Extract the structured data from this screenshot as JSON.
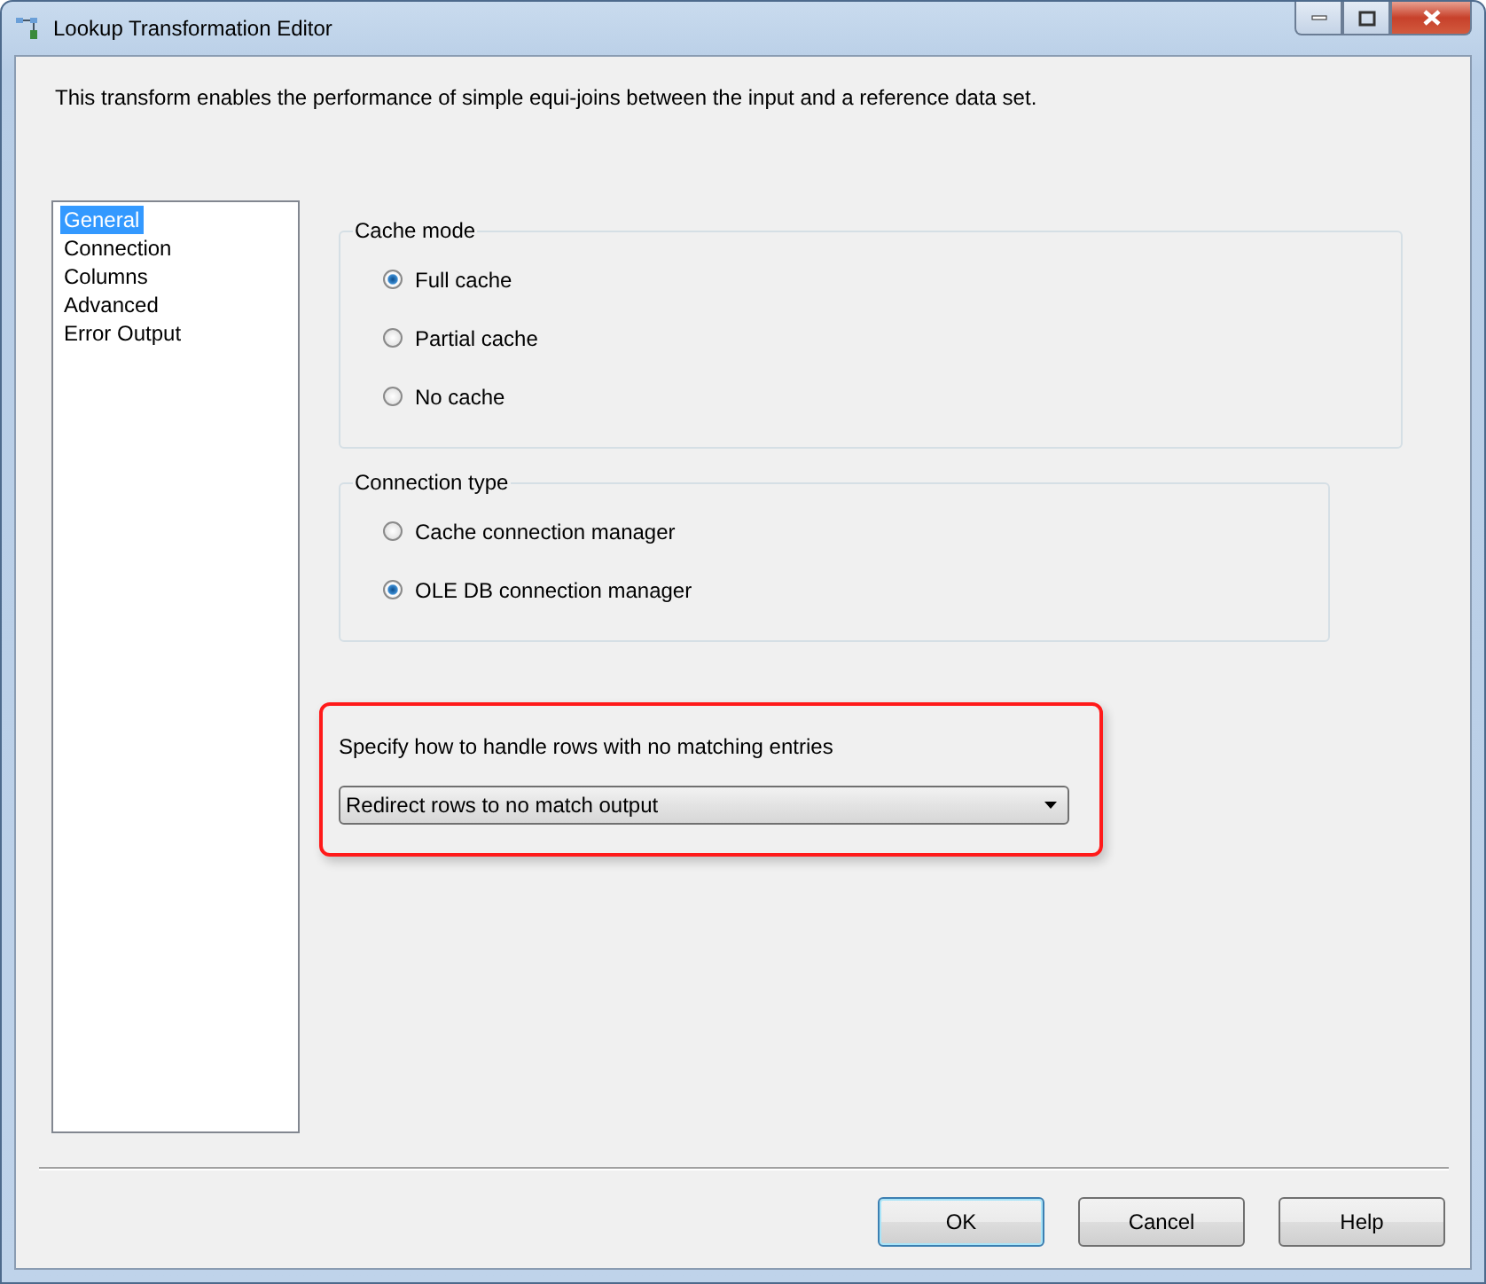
{
  "window": {
    "title": "Lookup Transformation Editor"
  },
  "description": "This transform enables the performance of simple equi-joins between the input and a reference data set.",
  "nav": [
    {
      "label": "General",
      "selected": true
    },
    {
      "label": "Connection",
      "selected": false
    },
    {
      "label": "Columns",
      "selected": false
    },
    {
      "label": "Advanced",
      "selected": false
    },
    {
      "label": "Error Output",
      "selected": false
    }
  ],
  "groups": [
    {
      "title": "Cache mode",
      "options": [
        {
          "label": "Full cache",
          "selected": true
        },
        {
          "label": "Partial cache",
          "selected": false
        },
        {
          "label": "No cache",
          "selected": false
        }
      ]
    },
    {
      "title": "Connection type",
      "options": [
        {
          "label": "Cache connection manager",
          "selected": false
        },
        {
          "label": "OLE DB connection manager",
          "selected": true
        }
      ]
    }
  ],
  "no_match": {
    "label": "Specify how to handle rows with no matching entries",
    "value": "Redirect rows to no match output",
    "highlighted": true
  },
  "buttons": [
    {
      "label": "OK",
      "default": true
    },
    {
      "label": "Cancel",
      "default": false
    },
    {
      "label": "Help",
      "default": false
    }
  ]
}
